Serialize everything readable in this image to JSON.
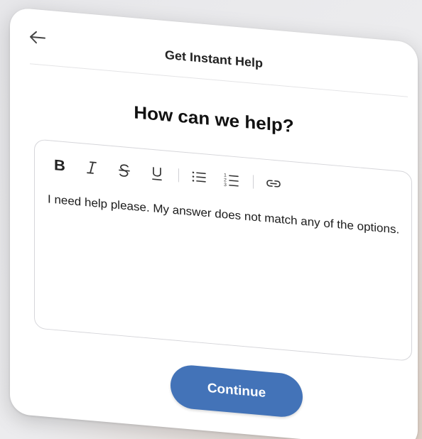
{
  "header": {
    "title": "Get Instant Help",
    "back_icon": "arrow-left-icon"
  },
  "main": {
    "heading": "How can we help?"
  },
  "editor": {
    "toolbar": [
      {
        "name": "bold-button",
        "icon": "bold-icon"
      },
      {
        "name": "italic-button",
        "icon": "italic-icon"
      },
      {
        "name": "strikethrough-button",
        "icon": "strikethrough-icon"
      },
      {
        "name": "underline-button",
        "icon": "underline-icon"
      },
      {
        "name": "bulleted-list-button",
        "icon": "bulleted-list-icon"
      },
      {
        "name": "numbered-list-button",
        "icon": "numbered-list-icon"
      },
      {
        "name": "link-button",
        "icon": "link-icon"
      }
    ],
    "content": "I need help please. My answer does not match any of the options."
  },
  "footer": {
    "continue_label": "Continue"
  },
  "colors": {
    "primary_button": "#4373b8",
    "text": "#111111",
    "border": "#d6d6da"
  }
}
